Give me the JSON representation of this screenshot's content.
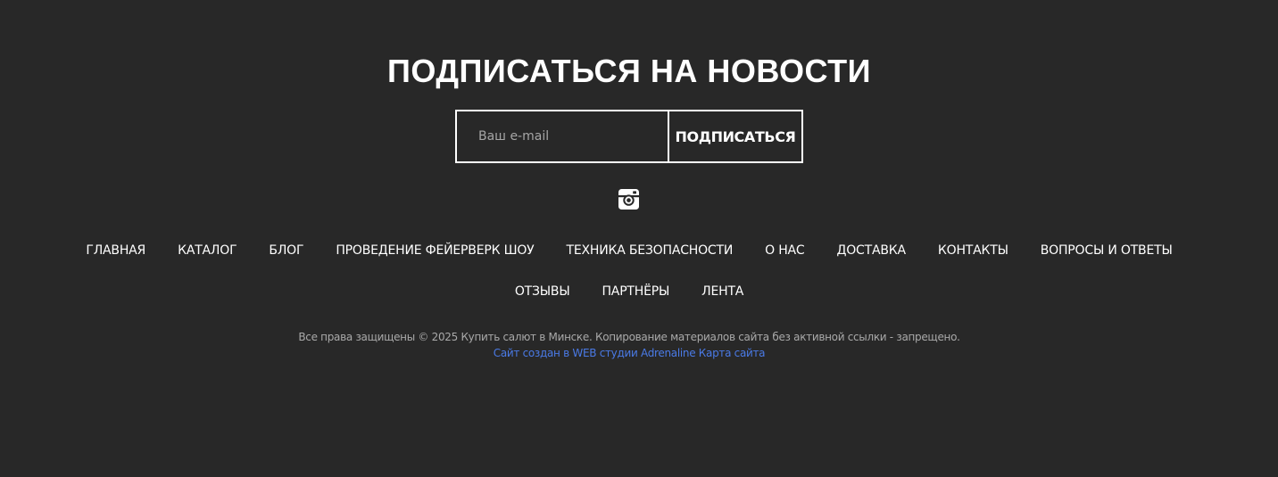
{
  "subscribe": {
    "title": "ПОДПИСАТЬСЯ НА НОВОСТИ",
    "email_placeholder": "Ваш e-mail",
    "email_value": "",
    "button_label": "ПОДПИСАТЬСЯ"
  },
  "social": {
    "icon": "instagram-icon"
  },
  "nav": {
    "row1": [
      "ГЛАВНАЯ",
      "КАТАЛОГ",
      "БЛОГ",
      "ПРОВЕДЕНИЕ ФЕЙЕРВЕРК ШОУ",
      "ТЕХНИКА БЕЗОПАСНОСТИ",
      "О НАС",
      "ДОСТАВКА",
      "КОНТАКТЫ",
      "ВОПРОСЫ И ОТВЕТЫ"
    ],
    "row2": [
      "ОТЗЫВЫ",
      "ПАРТНЁРЫ",
      "ЛЕНТА"
    ]
  },
  "footer": {
    "copyright": "Все права защищены © 2025 Купить салют в Минске. Копирование материалов сайта без активной ссылки - запрещено.",
    "studio_link": "Сайт создан в WEB студии Adrenaline",
    "sitemap_link": "Карта сайта"
  },
  "colors": {
    "background": "#282828",
    "text": "#ffffff",
    "muted": "#a9a9a9",
    "link": "#4a7ae6"
  }
}
